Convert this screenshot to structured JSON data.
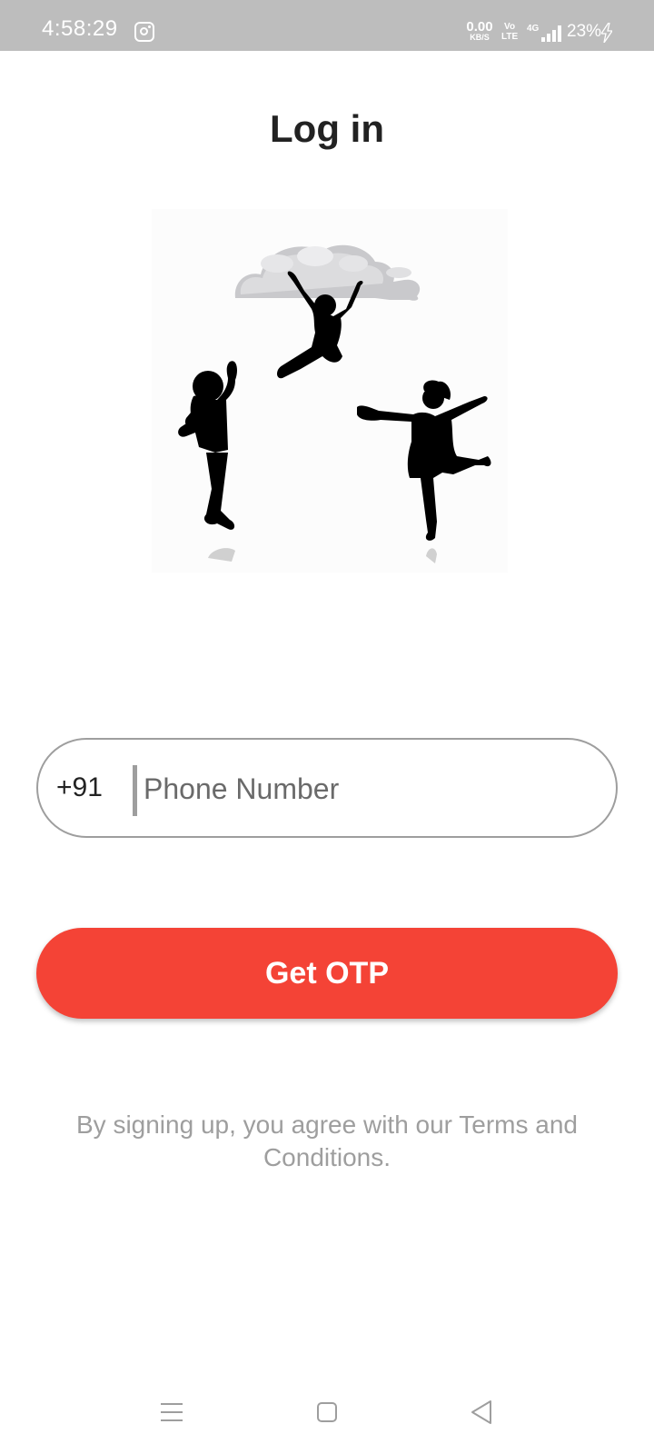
{
  "status_bar": {
    "time": "4:58:29",
    "speed_value": "0.00",
    "speed_unit": "KB/S",
    "volte_top": "Vo",
    "volte_bottom": "LTE",
    "network": "4G",
    "battery": "23%",
    "icons": [
      "instagram-icon",
      "signal-icon",
      "charging-icon"
    ]
  },
  "page": {
    "title": "Log in"
  },
  "illustration": {
    "icons": [
      "cloud",
      "jumping-children-silhouettes"
    ]
  },
  "phone": {
    "country_code": "+91",
    "value": "",
    "placeholder": "Phone Number"
  },
  "actions": {
    "get_otp_label": "Get OTP"
  },
  "terms": {
    "text": "By signing up, you agree with our Terms and Conditions."
  },
  "colors": {
    "accent": "#f44336",
    "status_bar": "#bdbdbd",
    "muted_text": "#9e9e9e"
  },
  "nav_bar": {
    "icons": [
      "menu-icon",
      "home-icon",
      "back-icon"
    ]
  }
}
